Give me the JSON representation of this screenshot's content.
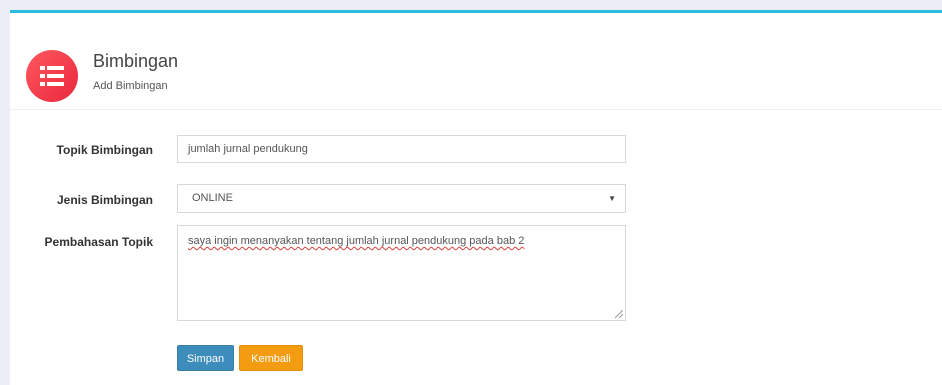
{
  "page": {
    "title": "Bimbingan",
    "subtitle": "Add Bimbingan",
    "icon": "list-icon"
  },
  "form": {
    "topik": {
      "label": "Topik Bimbingan",
      "value": "jumlah jurnal pendukung"
    },
    "jenis": {
      "label": "Jenis Bimbingan",
      "selected": "ONLINE"
    },
    "pembahasan": {
      "label": "Pembahasan Topik",
      "value": "saya ingin menanyakan tentang jumlah jurnal pendukung pada bab 2"
    }
  },
  "buttons": {
    "save_label": "Simpan",
    "back_label": "Kembali"
  },
  "colors": {
    "accent_top": "#2bbde0",
    "icon_circle": "#f23a4a",
    "save_button": "#3c8dbc",
    "back_button": "#f39c12"
  }
}
